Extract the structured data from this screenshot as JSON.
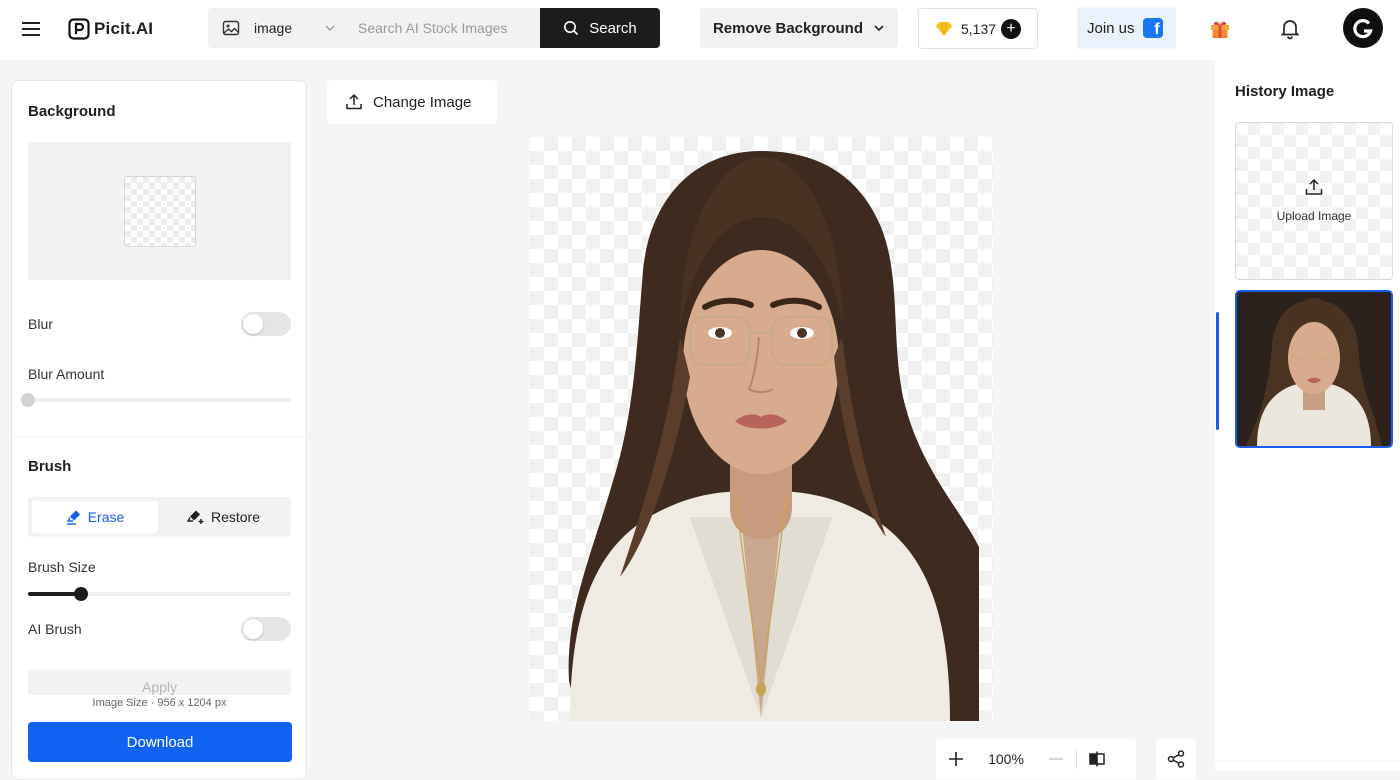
{
  "brand": {
    "name": "Picit.AI"
  },
  "search": {
    "type_label": "image",
    "placeholder": "Search AI Stock Images",
    "button_label": "Search"
  },
  "tool": {
    "label": "Remove Background"
  },
  "credits": {
    "value": "5,137"
  },
  "join": {
    "label": "Join us"
  },
  "left": {
    "background_title": "Background",
    "blur_label": "Blur",
    "blur_amount_label": "Blur Amount",
    "blur_amount_value": 0,
    "brush_title": "Brush",
    "erase_label": "Erase",
    "restore_label": "Restore",
    "brush_size_label": "Brush Size",
    "brush_size_value": 0.2,
    "ai_brush_label": "AI Brush",
    "apply_label": "Apply",
    "image_size": "Image Size · 956 x 1204 px",
    "download_label": "Download"
  },
  "canvas": {
    "change_image_label": "Change Image"
  },
  "zoom": {
    "value": "100%"
  },
  "history": {
    "title": "History Image",
    "upload_label": "Upload Image"
  },
  "colors": {
    "accent": "#1063f2",
    "active_blue": "#1a5cf0",
    "dark": "#1c1c1c"
  },
  "icons": [
    "menu-icon",
    "logo-icon",
    "image-icon",
    "chevron-down-icon",
    "search-icon",
    "gem-icon",
    "plus-icon",
    "facebook-icon",
    "gift-icon",
    "bell-icon",
    "user-avatar-icon",
    "upload-icon",
    "eraser-icon",
    "restore-brush-icon",
    "zoom-in-icon",
    "zoom-out-icon",
    "compare-icon",
    "share-icon"
  ]
}
